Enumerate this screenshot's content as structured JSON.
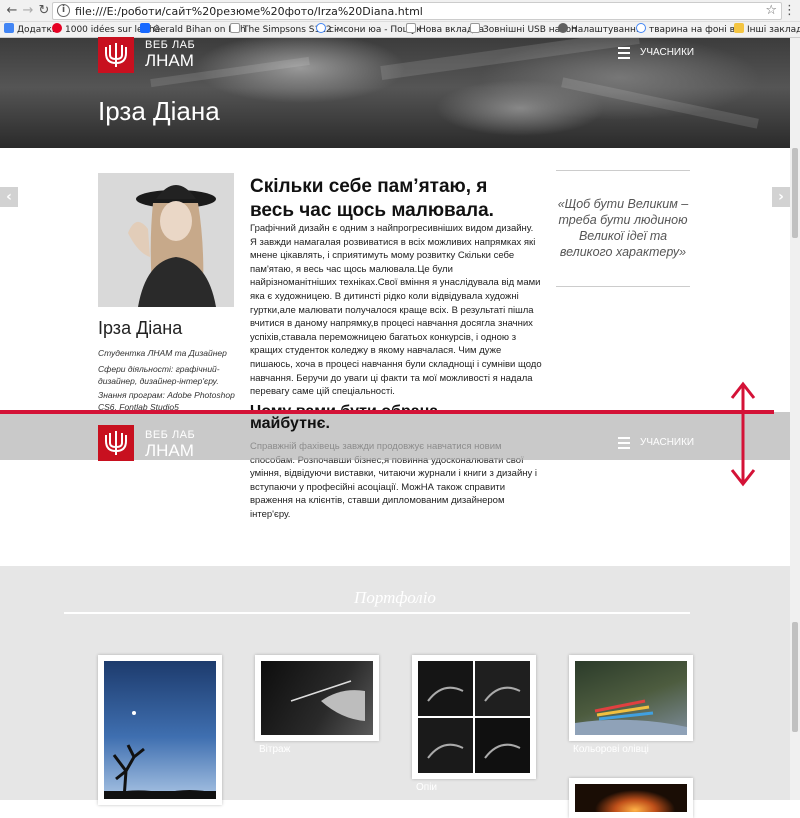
{
  "browser": {
    "url": "file:///E:/роботи/сайт%20резюме%20фото/Irza%20Diana.html",
    "info_glyph": "i",
    "bookmarks": [
      {
        "label": "Додатки",
        "color": "#4285f4"
      },
      {
        "label": "1000 idées sur le thè",
        "color": "#e60023"
      },
      {
        "label": "Gerald Bihan on Beh",
        "color": "#1769ff"
      },
      {
        "label": "The Simpsons S1E2 -",
        "color": "#9e9e9e"
      },
      {
        "label": "сімсони юа - Пошук",
        "color": "#4285f4"
      },
      {
        "label": "Нова вкладка",
        "color": "#9e9e9e"
      },
      {
        "label": "Зовнішні USB накоп",
        "color": "#9e9e9e"
      },
      {
        "label": "Налаштування",
        "color": "#616161"
      },
      {
        "label": "тварина на фоні вік",
        "color": "#4285f4"
      },
      {
        "label": "Інші закладки",
        "color": "#f4c542"
      }
    ]
  },
  "site": {
    "logo_line1": "ВЕБ ЛАБ",
    "logo_line2": "ЛНАМ",
    "menu_label": "УЧАСНИКИ",
    "brand_color": "#c8101f"
  },
  "hero": {
    "title": "Ірза Діана"
  },
  "profile": {
    "name": "Ірза Діана",
    "role": "Студентка ЛНАМ та Дизайнер",
    "spheres": "Сфери діяльності: графічний-дизайнер, дизайнер-інтер'єру.",
    "programs": "Знання програм: Adobe Photoshop CS6, Fontlab Studio5"
  },
  "about": {
    "heading": "Скільки себе пам’ятаю, я весь час щось малювала.",
    "paragraph": "Графічний дизайн є одним з найпрогресивніших видом дизайну. Я завжди намагалая розвиватися в всіх можливих напрямках які мнене цікавлять, і сприятимуть мому розвитку Скільки себе пам'ятаю, я весь час щось малювала.Це були найрізноманітніших техніках.Свої вміння я унаслідувала від мами яка є художницею. В дитинсті рідко коли відвідувала художні гуртки,але малювати получалося краще всіх. В результаті пішла вчитися в даному напрямку,в процесі навчання досягла значних успіхів,ставала переможницею багатьох конкурсів, і одною з кращих студенток коледжу в якому навчалася. Чим дуже пишаюсь, хоча в процесі навчання були складнощі і сумніви щодо навчання. Беручи до уваги ці факти та мої можливості я надала перевагу саме цій спеціальності.",
    "heading2": "Чому вами бути обрана",
    "heading2_tail": "майбутнє.",
    "paragraph2": "Справжній фахівець завжди продовжує навчатися новим способам. Розпочавши бізнес,я повинна удосконалювати свої уміння, відвідуючи виставки, читаючи журнали і книги з дизайну і вступаючи у професійні асоціації. МожНА також справити враження на клієнтів, ставши дипломованим дизайнером інтер'єру."
  },
  "quote": "«Щоб бути Великим – треба бути людиною Великої ідеї та великого характеру»",
  "portfolio": {
    "title": "Портфоліо",
    "items": [
      {
        "caption": ""
      },
      {
        "caption": "Вітраж"
      },
      {
        "caption": "Опіи"
      },
      {
        "caption": "Кольорові олівці"
      }
    ]
  },
  "accent_red": "#d41237"
}
